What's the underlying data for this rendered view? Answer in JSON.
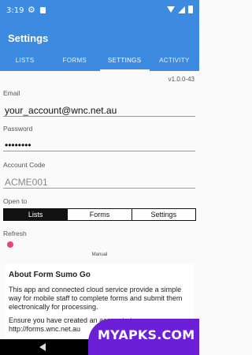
{
  "status": {
    "time": "3:19"
  },
  "app": {
    "title": "Settings"
  },
  "tabs": [
    {
      "label": "LISTS"
    },
    {
      "label": "FORMS"
    },
    {
      "label": "SETTINGS"
    },
    {
      "label": "ACTIVITY"
    }
  ],
  "version": "v1.0.0-43",
  "email": {
    "label": "Email",
    "value": "your_account@wnc.net.au"
  },
  "password": {
    "label": "Password",
    "value": "••••••••"
  },
  "account": {
    "label": "Account Code",
    "value": "ACME001"
  },
  "open_to": {
    "label": "Open to",
    "options": [
      "Lists",
      "Forms",
      "Settings"
    ],
    "selected": "Lists"
  },
  "refresh": {
    "label": "Refresh",
    "toggle_color": "#e8437a"
  },
  "manual_label": "Manual",
  "about": {
    "title": "About Form Sumo Go",
    "paragraph1": "This app and connected cloud service provide a simple way for mobile staff to complete forms and submit them electronically for processing.",
    "paragraph2": "Ensure you have created an account at http://forms.wnc.net.au"
  },
  "watermark": "MYAPKS.COM",
  "colors": {
    "primary": "#3d8be0",
    "watermark": "#6b1fd6"
  }
}
